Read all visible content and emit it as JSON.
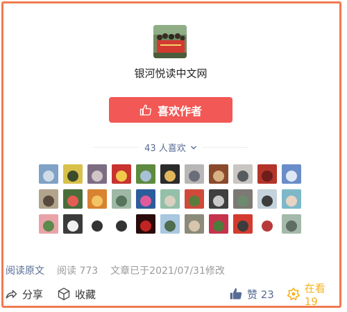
{
  "account": {
    "name": "银河悦读中文网"
  },
  "like_button": {
    "label": "喜欢作者"
  },
  "likers": {
    "count_text": "43 人喜欢"
  },
  "avatars": [
    {
      "c1": "#7fa2c6",
      "c2": "#cfdbe6"
    },
    {
      "c1": "#d8c14a",
      "c2": "#3d4b2a"
    },
    {
      "c1": "#7d6d83",
      "c2": "#d1c5c7"
    },
    {
      "c1": "#c8332f",
      "c2": "#f2c84b"
    },
    {
      "c1": "#5e8a3f",
      "c2": "#a8c0d8"
    },
    {
      "c1": "#2b2b2b",
      "c2": "#e2b65d"
    },
    {
      "c1": "#b9b7b6",
      "c2": "#6b6e7a"
    },
    {
      "c1": "#8a4a2b",
      "c2": "#d8b184"
    },
    {
      "c1": "#c9c6c2",
      "c2": "#575a5f"
    },
    {
      "c1": "#b3342b",
      "c2": "#6e1d1a"
    },
    {
      "c1": "#6a8dc9",
      "c2": "#dfe8f5"
    },
    {
      "c1": "#b1a38c",
      "c2": "#574a3c"
    },
    {
      "c1": "#4a6d3b",
      "c2": "#e25d53"
    },
    {
      "c1": "#d98230",
      "c2": "#f3c466"
    },
    {
      "c1": "#9fb7a5",
      "c2": "#56735c"
    },
    {
      "c1": "#2c5d9b",
      "c2": "#e05b9b"
    },
    {
      "c1": "#94bfa8",
      "c2": "#d8d0c1"
    },
    {
      "c1": "#d04a3b",
      "c2": "#5a7d3c"
    },
    {
      "c1": "#3f3f3f",
      "c2": "#c9c9c9"
    },
    {
      "c1": "#7d7a76",
      "c2": "#6d8b6e"
    },
    {
      "c1": "#c4d2db",
      "c2": "#3d3d3d"
    },
    {
      "c1": "#7db8c9",
      "c2": "#e7d4c4"
    },
    {
      "c1": "#e8a3a8",
      "c2": "#5b8a4d"
    },
    {
      "c1": "#3b3b3b",
      "c2": "#f1f1f1"
    },
    {
      "c1": "#ffffff",
      "c2": "#333333"
    },
    {
      "c1": "#ffffff",
      "c2": "#333333"
    },
    {
      "c1": "#2a0a0a",
      "c2": "#c02523"
    },
    {
      "c1": "#a8c7e0",
      "c2": "#4f6d4f"
    },
    {
      "c1": "#8b8b79",
      "c2": "#d6c6ad"
    },
    {
      "c1": "#c5334d",
      "c2": "#4e7a3c"
    },
    {
      "c1": "#d33b2f",
      "c2": "#3c3c3c"
    },
    {
      "c1": "#ffffff",
      "c2": "#b73a3a"
    },
    {
      "c1": "#a4b9a9",
      "c2": "#5f6e65"
    }
  ],
  "meta": {
    "read_source": "阅读原文",
    "read_count": "阅读 773",
    "edited": "文章已于2021/07/31修改"
  },
  "actions": {
    "share": "分享",
    "collect": "收藏",
    "zan": "赞 23",
    "watching": "在看 19"
  },
  "colors": {
    "frame": "#f07a4f",
    "like_button": "#f25855",
    "link": "#576b95",
    "watching": "#f5b21d"
  }
}
